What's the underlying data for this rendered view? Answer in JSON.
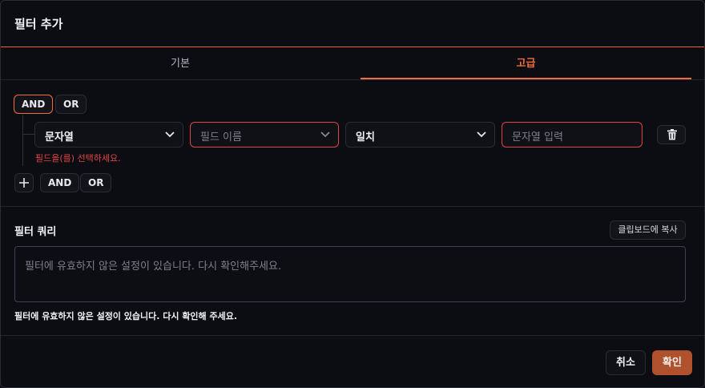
{
  "dialog": {
    "title": "필터 추가"
  },
  "tabs": [
    {
      "label": "기본"
    },
    {
      "label": "고급"
    }
  ],
  "active_tab": "고급",
  "group_ops": {
    "and": "AND",
    "or": "OR",
    "active": "AND"
  },
  "rule": {
    "type_select": {
      "value": "문자열"
    },
    "field_select": {
      "placeholder": "필드 이름"
    },
    "op_select": {
      "value": "일치"
    },
    "value_input": {
      "placeholder": "문자열 입력"
    },
    "error": "필드을(를) 선택하세요."
  },
  "add_ops": {
    "and": "AND",
    "or": "OR"
  },
  "query": {
    "title": "필터 쿼리",
    "copy_label": "클립보드에 복사",
    "placeholder": "필터에 유효하지 않은 설정이 있습니다. 다시 확인해주세요.",
    "note": "필터에 유효하지 않은 설정이 있습니다. 다시 확인해 주세요."
  },
  "footer": {
    "cancel": "취소",
    "confirm": "확인"
  },
  "colors": {
    "accent": "#f26d3b",
    "error": "#e04545",
    "confirm_bg": "#b0512e",
    "background": "#0c0d12"
  },
  "icons": {
    "chevron": "chevron-down-icon",
    "delete": "trash-icon",
    "add": "plus-icon"
  }
}
